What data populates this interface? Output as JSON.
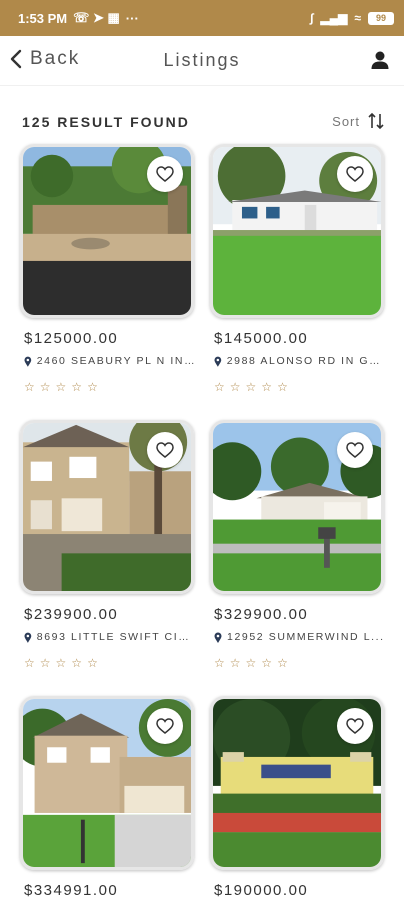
{
  "status_bar": {
    "time": "1:53 PM",
    "dots": "···",
    "battery": "99"
  },
  "header": {
    "back_label": "Back",
    "title": "Listings"
  },
  "results": {
    "count_label": "125 RESULT FOUND",
    "sort_label": "Sort"
  },
  "colors": {
    "accent": "#b0894a",
    "text": "#333333"
  },
  "listings": [
    {
      "price": "$125000.00",
      "address": "2460 SEABURY PL N IN ...",
      "rating": 0,
      "scene": "yard"
    },
    {
      "price": "$145000.00",
      "address": "2988 ALONSO RD IN GR...",
      "rating": 0,
      "scene": "ranch"
    },
    {
      "price": "$239900.00",
      "address": "8693 LITTLE SWIFT CIR...",
      "rating": 0,
      "scene": "townhouse"
    },
    {
      "price": "$329900.00",
      "address": "12952 SUMMERWIND L...",
      "rating": 0,
      "scene": "trees"
    },
    {
      "price": "$334991.00",
      "address": "",
      "rating": 0,
      "scene": "twostory"
    },
    {
      "price": "$190000.00",
      "address": "",
      "rating": 0,
      "scene": "sign"
    }
  ]
}
